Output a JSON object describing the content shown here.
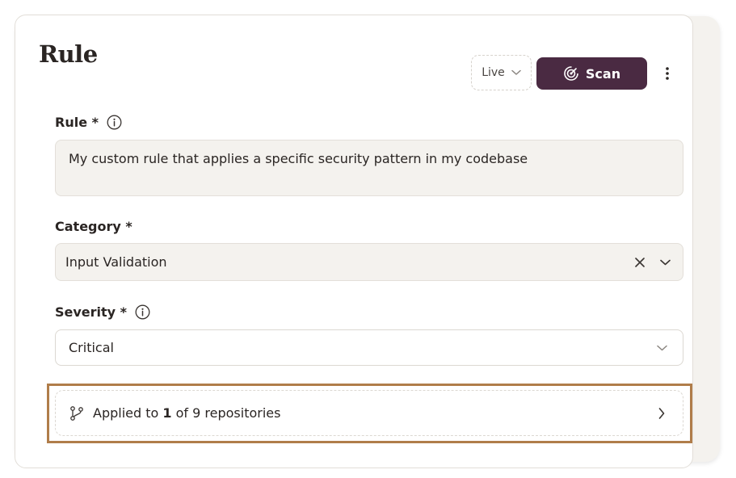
{
  "header": {
    "title": "Rule",
    "status_select": {
      "value": "Live"
    },
    "scan_label": "Scan"
  },
  "form": {
    "rule": {
      "label": "Rule *",
      "value": "My custom rule that applies a specific security pattern in my codebase"
    },
    "category": {
      "label": "Category *",
      "value": "Input Validation"
    },
    "severity": {
      "label": "Severity *",
      "value": "Critical"
    }
  },
  "repositories": {
    "prefix": "Applied to ",
    "applied_count": "1",
    "middle": " of ",
    "total_count": "9",
    "suffix": " repositories"
  },
  "colors": {
    "scan_button": "#4a2a42",
    "input_fill": "#f4f2ee",
    "highlight_border": "#b07d4a"
  }
}
